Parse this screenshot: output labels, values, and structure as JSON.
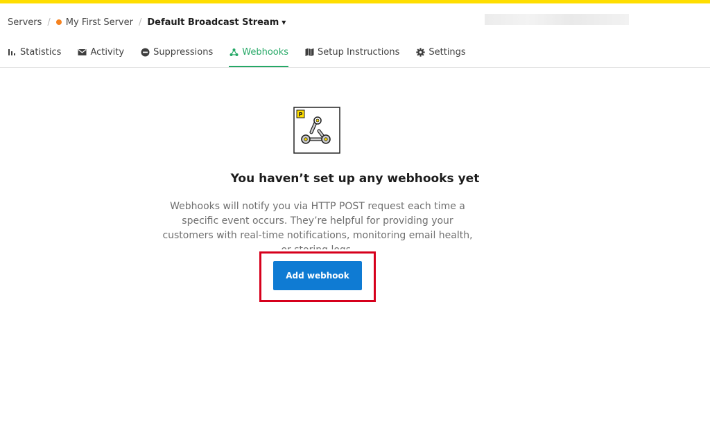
{
  "breadcrumb": {
    "servers_label": "Servers",
    "server_name": "My First Server",
    "stream_name": "Default Broadcast Stream",
    "status_color": "#f5821f"
  },
  "tabs": [
    {
      "label": "Statistics",
      "icon": "bar-chart-icon",
      "active": false
    },
    {
      "label": "Activity",
      "icon": "envelope-icon",
      "active": false
    },
    {
      "label": "Suppressions",
      "icon": "block-icon",
      "active": false
    },
    {
      "label": "Webhooks",
      "icon": "webhook-icon",
      "active": true
    },
    {
      "label": "Setup Instructions",
      "icon": "map-icon",
      "active": false
    },
    {
      "label": "Settings",
      "icon": "gear-icon",
      "active": false
    }
  ],
  "empty_state": {
    "title": "You haven’t set up any webhooks yet",
    "description": "Webhooks will notify you via HTTP POST request each time a specific event occurs. They’re helpful for providing your customers with real-time notifications, monitoring email health, or storing logs.",
    "button_label": "Add webhook",
    "badge_letter": "P"
  },
  "colors": {
    "accent_yellow": "#ffde00",
    "active_tab": "#25a866",
    "primary_button": "#0f7bd3",
    "highlight": "#d6001c"
  }
}
